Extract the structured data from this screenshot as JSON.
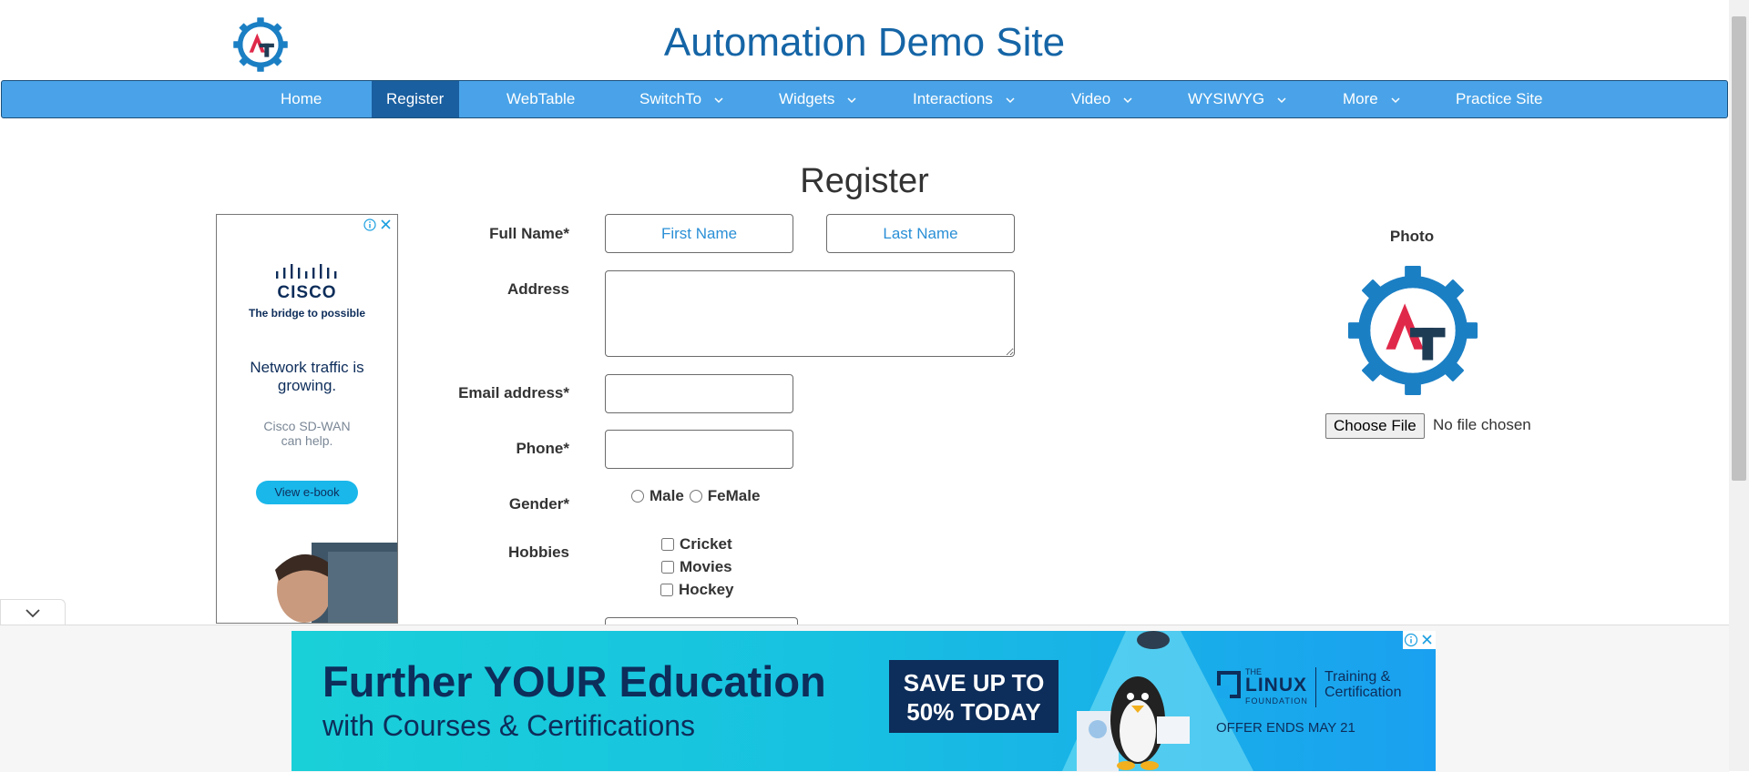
{
  "header": {
    "title": "Automation Demo Site"
  },
  "nav": {
    "items": [
      {
        "label": "Home"
      },
      {
        "label": "Register"
      },
      {
        "label": "WebTable"
      },
      {
        "label": "SwitchTo"
      },
      {
        "label": "Widgets"
      },
      {
        "label": "Interactions"
      },
      {
        "label": "Video"
      },
      {
        "label": "WYSIWYG"
      },
      {
        "label": "More"
      },
      {
        "label": "Practice Site"
      }
    ],
    "active": "Register"
  },
  "form": {
    "heading": "Register",
    "full_name_label": "Full Name*",
    "first_name_placeholder": "First Name",
    "last_name_placeholder": "Last Name",
    "address_label": "Address",
    "email_label": "Email address*",
    "phone_label": "Phone*",
    "gender_label": "Gender*",
    "gender_options": [
      "Male",
      "FeMale"
    ],
    "hobbies_label": "Hobbies",
    "hobbies": [
      "Cricket",
      "Movies",
      "Hockey"
    ]
  },
  "photo": {
    "label": "Photo",
    "choose_button": "Choose File",
    "status": "No file chosen"
  },
  "left_ad": {
    "brand": "CISCO",
    "tagline": "The bridge to possible",
    "headline": "Network traffic is growing.",
    "sub": "Cisco SD-WAN can help.",
    "cta": "View e-book"
  },
  "bottom_ad": {
    "headline": "Further YOUR Education",
    "sub": "with Courses & Certifications",
    "badge_line1": "SAVE UP TO",
    "badge_line2": "50% TODAY",
    "org_small": "THE",
    "org": "LINUX",
    "org_sub": "FOUNDATION",
    "program": "Training & Certification",
    "offer": "OFFER ENDS MAY 21"
  },
  "colors": {
    "nav_bg": "#4aa3e8",
    "nav_active": "#1a5fa0",
    "title": "#1565a6",
    "placeholder": "#2a8fd6",
    "logo_blue": "#1b7fc4",
    "logo_red": "#e0294a",
    "logo_dark": "#1f3c55"
  }
}
